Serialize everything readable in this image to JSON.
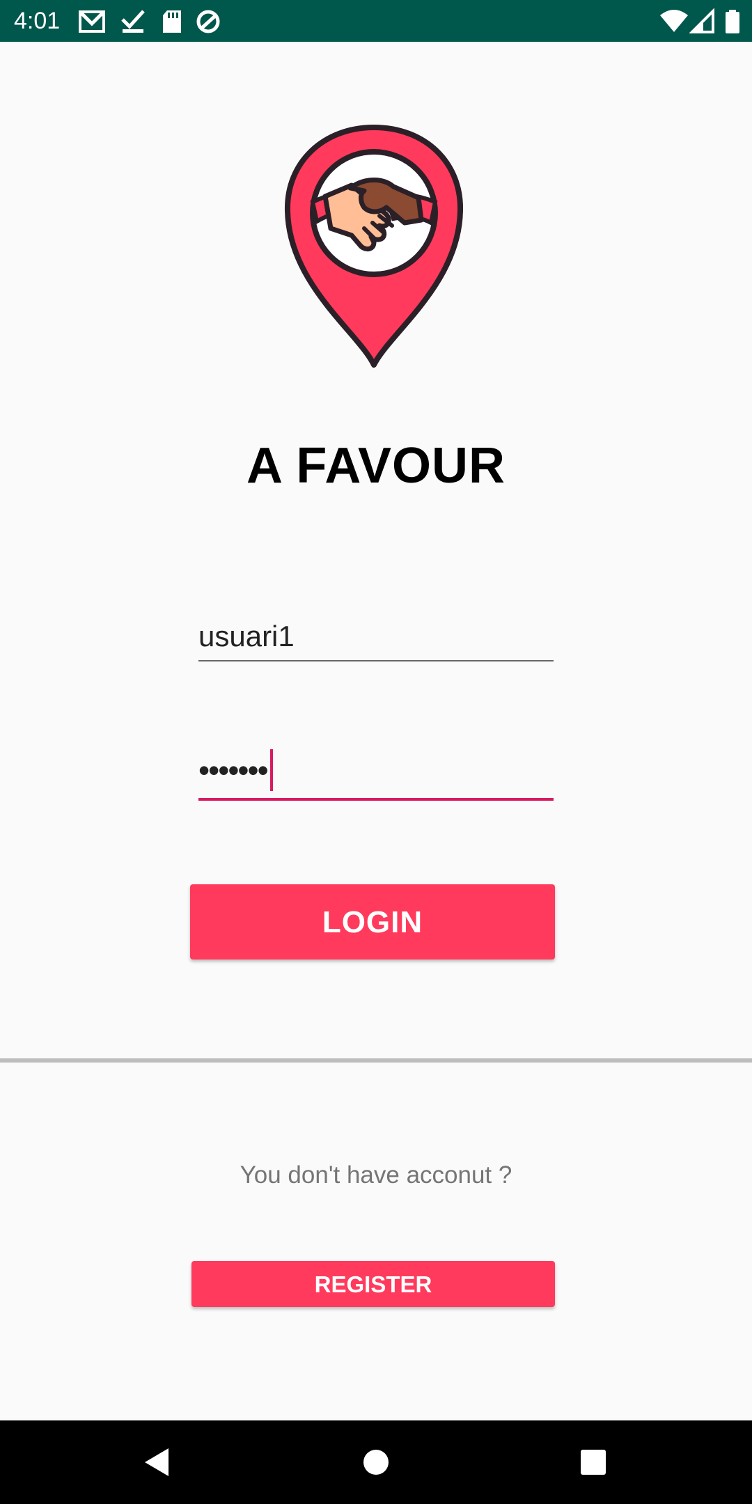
{
  "status_bar": {
    "time": "4:01",
    "left_icons": [
      "gmail-icon",
      "checkmark-icon",
      "sd-card-icon",
      "data-saver-icon"
    ],
    "right_icons": [
      "wifi-icon",
      "cell-signal-icon",
      "battery-icon"
    ]
  },
  "app": {
    "title": "A FAVOUR",
    "logo_icon": "handshake-location-pin-icon"
  },
  "login_form": {
    "username_value": "usuari1",
    "password_value": "•••••••",
    "login_label": "LOGIN"
  },
  "register_section": {
    "prompt": "You don't have acconut ?",
    "register_label": "REGISTER"
  },
  "nav_bar": {
    "buttons": [
      "back-icon",
      "home-icon",
      "recents-icon"
    ]
  },
  "colors": {
    "status_bar": "#00574b",
    "accent": "#ff3a5c",
    "focus_underline": "#d81b60",
    "background": "#fafafa"
  }
}
